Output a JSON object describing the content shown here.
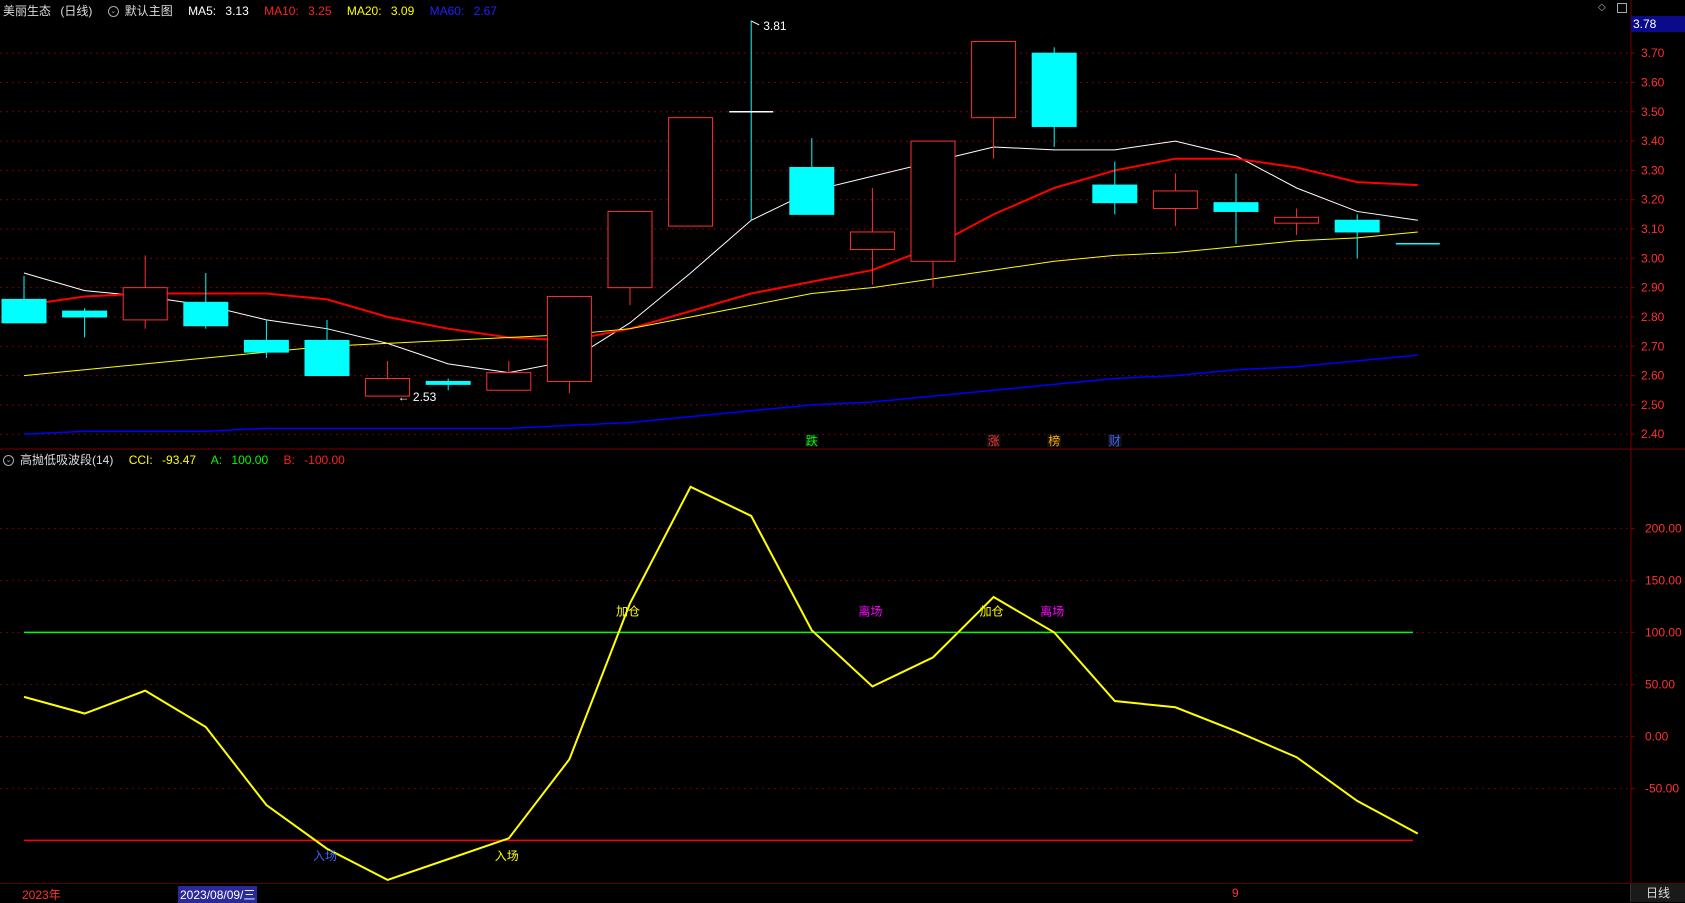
{
  "header": {
    "stock_name": "美丽生态",
    "period": "(日线)",
    "main_chart_label": "默认主图",
    "ma5_label": "MA5:",
    "ma5_value": "3.13",
    "ma10_label": "MA10:",
    "ma10_value": "3.25",
    "ma20_label": "MA20:",
    "ma20_value": "3.09",
    "ma60_label": "MA60:",
    "ma60_value": "2.67",
    "current_price": "3.78"
  },
  "indicator_header": {
    "name": "高抛低吸波段(14)",
    "cci_label": "CCI:",
    "cci_value": "-93.47",
    "a_label": "A:",
    "a_value": "100.00",
    "b_label": "B:",
    "b_value": "-100.00"
  },
  "bottom": {
    "year_label": "2023年",
    "date_label": "2023/08/09/三",
    "month_label": "9",
    "period_tab": "日线"
  },
  "colors": {
    "up": "#ff3030",
    "down": "#00ffff",
    "ma5": "#ffffff",
    "ma10": "#ff0000",
    "ma20": "#ffff00",
    "ma60": "#0000ff",
    "cci": "#ffff00",
    "a_line": "#00ff00",
    "b_line": "#ff0000",
    "grid": "#7a0000",
    "axis_text": "#ff3030"
  },
  "chart_data": [
    {
      "type": "candlestick",
      "title": "美丽生态 (日线)",
      "y_ticks": [
        2.4,
        2.5,
        2.6,
        2.7,
        2.8,
        2.9,
        3.0,
        3.1,
        3.2,
        3.3,
        3.4,
        3.5,
        3.6,
        3.7
      ],
      "y_tick_labels": [
        "2.40",
        "2.50",
        "2.60",
        "2.70",
        "2.80",
        "2.90",
        "3.00",
        "3.10",
        "3.20",
        "3.30",
        "3.40",
        "3.50",
        "3.60",
        "3.70"
      ],
      "ylim": [
        2.37,
        3.82
      ],
      "candles": [
        {
          "o": 2.86,
          "h": 2.94,
          "l": 2.78,
          "c": 2.78
        },
        {
          "o": 2.82,
          "h": 2.83,
          "l": 2.73,
          "c": 2.8
        },
        {
          "o": 2.79,
          "h": 3.01,
          "l": 2.76,
          "c": 2.9
        },
        {
          "o": 2.85,
          "h": 2.95,
          "l": 2.76,
          "c": 2.77
        },
        {
          "o": 2.72,
          "h": 2.79,
          "l": 2.66,
          "c": 2.68
        },
        {
          "o": 2.72,
          "h": 2.79,
          "l": 2.6,
          "c": 2.6
        },
        {
          "o": 2.53,
          "h": 2.65,
          "l": 2.53,
          "c": 2.59
        },
        {
          "o": 2.58,
          "h": 2.59,
          "l": 2.55,
          "c": 2.57
        },
        {
          "o": 2.55,
          "h": 2.65,
          "l": 2.55,
          "c": 2.61
        },
        {
          "o": 2.58,
          "h": 2.87,
          "l": 2.54,
          "c": 2.87
        },
        {
          "o": 2.9,
          "h": 3.16,
          "l": 2.84,
          "c": 3.16
        },
        {
          "o": 3.11,
          "h": 3.48,
          "l": 3.11,
          "c": 3.48
        },
        {
          "o": 3.5,
          "h": 3.81,
          "l": 3.13,
          "c": 3.5
        },
        {
          "o": 3.31,
          "h": 3.41,
          "l": 3.15,
          "c": 3.15
        },
        {
          "o": 3.03,
          "h": 3.24,
          "l": 2.91,
          "c": 3.09
        },
        {
          "o": 2.99,
          "h": 3.4,
          "l": 2.9,
          "c": 3.4
        },
        {
          "o": 3.48,
          "h": 3.74,
          "l": 3.34,
          "c": 3.74
        },
        {
          "o": 3.7,
          "h": 3.72,
          "l": 3.38,
          "c": 3.45
        },
        {
          "o": 3.25,
          "h": 3.33,
          "l": 3.15,
          "c": 3.19
        },
        {
          "o": 3.17,
          "h": 3.29,
          "l": 3.11,
          "c": 3.23
        },
        {
          "o": 3.19,
          "h": 3.29,
          "l": 3.05,
          "c": 3.16
        },
        {
          "o": 3.12,
          "h": 3.17,
          "l": 3.08,
          "c": 3.14
        },
        {
          "o": 3.13,
          "h": 3.15,
          "l": 3.0,
          "c": 3.09
        },
        {
          "o": 3.05,
          "h": 3.05,
          "l": 3.05,
          "c": 3.05
        }
      ],
      "annotations": [
        {
          "text": "3.81",
          "candle": 12,
          "price": 3.81
        },
        {
          "text": "2.53",
          "candle": 6,
          "price": 2.53
        }
      ],
      "series": [
        {
          "name": "MA5",
          "values": [
            2.95,
            2.89,
            2.87,
            2.84,
            2.79,
            2.76,
            2.71,
            2.64,
            2.61,
            2.65,
            2.78,
            2.95,
            3.13,
            3.23,
            3.28,
            3.33,
            3.38,
            3.37,
            3.37,
            3.4,
            3.35,
            3.24,
            3.16,
            3.13
          ]
        },
        {
          "name": "MA10",
          "values": [
            2.84,
            2.87,
            2.88,
            2.88,
            2.88,
            2.86,
            2.8,
            2.76,
            2.73,
            2.72,
            2.76,
            2.82,
            2.88,
            2.92,
            2.96,
            3.04,
            3.15,
            3.24,
            3.3,
            3.34,
            3.34,
            3.31,
            3.26,
            3.25
          ]
        },
        {
          "name": "MA20",
          "values": [
            2.6,
            2.62,
            2.64,
            2.66,
            2.68,
            2.7,
            2.71,
            2.72,
            2.73,
            2.74,
            2.76,
            2.8,
            2.84,
            2.88,
            2.9,
            2.93,
            2.96,
            2.99,
            3.01,
            3.02,
            3.04,
            3.06,
            3.07,
            3.09
          ]
        },
        {
          "name": "MA60",
          "values": [
            2.4,
            2.41,
            2.41,
            2.41,
            2.42,
            2.42,
            2.42,
            2.42,
            2.42,
            2.43,
            2.44,
            2.46,
            2.48,
            2.5,
            2.51,
            2.53,
            2.55,
            2.57,
            2.59,
            2.6,
            2.62,
            2.63,
            2.65,
            2.67
          ]
        }
      ],
      "event_markers": [
        {
          "text": "跌",
          "candle": 13,
          "color": "#00ff00"
        },
        {
          "text": "涨",
          "candle": 16,
          "color": "#ff3030"
        },
        {
          "text": "榜",
          "candle": 17,
          "color": "#ffaa00"
        },
        {
          "text": "财",
          "candle": 18,
          "color": "#4060ff"
        }
      ]
    },
    {
      "type": "line",
      "title": "高抛低吸波段(14)",
      "y_ticks": [
        -50,
        0,
        50,
        100,
        150,
        200
      ],
      "y_tick_labels": [
        "-50.00",
        "0.00",
        "50.00",
        "100.00",
        "150.00",
        "200.00"
      ],
      "ylim": [
        -140,
        260
      ],
      "series": [
        {
          "name": "CCI",
          "values": [
            38,
            22,
            44,
            9,
            -66,
            -108,
            -138,
            -118,
            -98,
            -22,
            128,
            240,
            212,
            102,
            48,
            76,
            134,
            100,
            34,
            28,
            5,
            -20,
            -62,
            -93.47
          ]
        },
        {
          "name": "A",
          "constant": 100
        },
        {
          "name": "B",
          "constant": -100
        }
      ],
      "signals": [
        {
          "text": "入场",
          "candle": 5,
          "y": -115,
          "color": "#4060ff"
        },
        {
          "text": "入场",
          "candle": 8,
          "y": -115,
          "color": "#ffff00"
        },
        {
          "text": "加仓",
          "candle": 10,
          "y": 120,
          "color": "#ffff00"
        },
        {
          "text": "离场",
          "candle": 14,
          "y": 120,
          "color": "#ff00ff"
        },
        {
          "text": "加仓",
          "candle": 16,
          "y": 120,
          "color": "#ffff00"
        },
        {
          "text": "离场",
          "candle": 17,
          "y": 120,
          "color": "#ff00ff"
        }
      ]
    }
  ]
}
